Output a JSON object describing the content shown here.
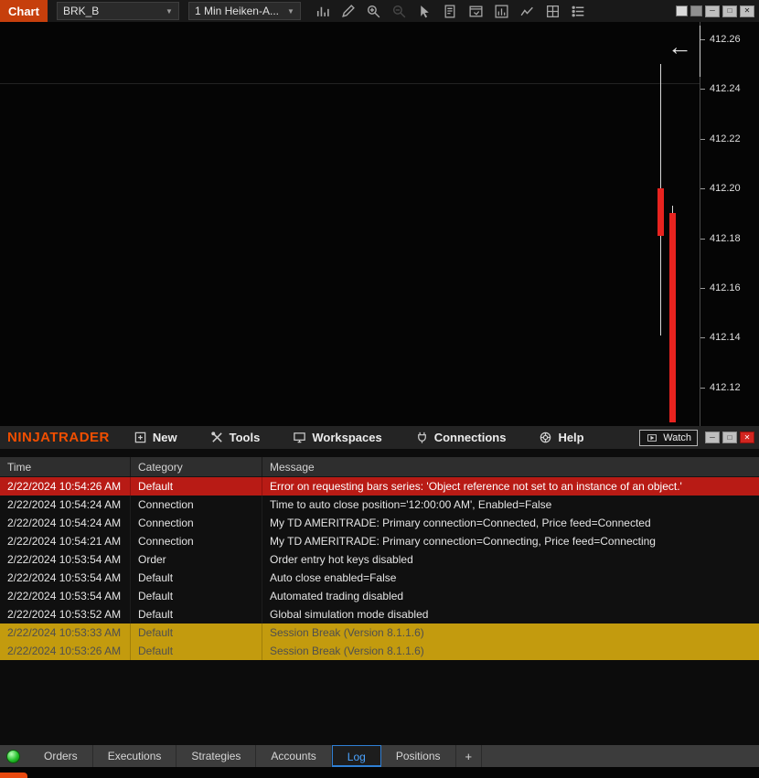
{
  "chart_window": {
    "title": "Chart",
    "instrument": "BRK_B",
    "period": "1 Min Heiken-A...",
    "back_arrow": "←",
    "toolbar_icons": [
      {
        "name": "chart-style-icon"
      },
      {
        "name": "drawing-tools-icon"
      },
      {
        "name": "zoom-in-icon"
      },
      {
        "name": "zoom-out-icon",
        "disabled": true
      },
      {
        "name": "cursor-icon"
      },
      {
        "name": "report-icon"
      },
      {
        "name": "window-link-icon"
      },
      {
        "name": "chart-trader-icon"
      },
      {
        "name": "indicators-icon"
      },
      {
        "name": "data-grid-icon"
      },
      {
        "name": "properties-icon"
      }
    ],
    "window_controls": [
      {
        "name": "layout-square-light-icon",
        "glyph": "",
        "fill": "#d9d9d9"
      },
      {
        "name": "layout-square-gray-icon",
        "glyph": "",
        "fill": "#8f8f8f"
      },
      {
        "name": "minimize-button",
        "glyph": "─"
      },
      {
        "name": "maximize-button",
        "glyph": "□"
      },
      {
        "name": "close-button",
        "glyph": "✕"
      }
    ]
  },
  "chart_data": {
    "type": "candlestick",
    "title": "BRK_B 1 Min Heiken-Ashi",
    "ylim": [
      412.1045,
      412.267
    ],
    "y_ticks": [
      "412.26",
      "412.24",
      "412.22",
      "412.20",
      "412.18",
      "412.16",
      "412.14",
      "412.12"
    ],
    "gridlines": [
      412.2425
    ],
    "candles": [
      {
        "x": 719,
        "open": 412.2,
        "high": 412.25,
        "low": 412.141,
        "close": 412.181,
        "direction": "down"
      },
      {
        "x": 732,
        "open": 412.19,
        "high": 412.193,
        "low": 412.106,
        "close": 412.106,
        "direction": "down"
      }
    ],
    "down_color": "#e8231f",
    "wick_color": "#d8d8d8"
  },
  "control_center": {
    "logo": "NINJATRADER",
    "menus": [
      {
        "name": "menu-new",
        "icon": "new-icon",
        "label": "New"
      },
      {
        "name": "menu-tools",
        "icon": "tools-icon",
        "label": "Tools"
      },
      {
        "name": "menu-workspaces",
        "icon": "workspaces-icon",
        "label": "Workspaces"
      },
      {
        "name": "menu-connections",
        "icon": "connections-icon",
        "label": "Connections"
      },
      {
        "name": "menu-help",
        "icon": "help-icon",
        "label": "Help"
      }
    ],
    "watch_button": {
      "label": "Watch"
    },
    "window_controls": [
      {
        "name": "minimize-button",
        "glyph": "─"
      },
      {
        "name": "maximize-button",
        "glyph": "□"
      },
      {
        "name": "close-button",
        "glyph": "✕",
        "bg": "#d22620",
        "fg": "#ffffff"
      }
    ],
    "log_table": {
      "columns": [
        "Time",
        "Category",
        "Message"
      ],
      "rows": [
        {
          "time": "2/22/2024 10:54:26 AM",
          "category": "Default",
          "message": "Error on requesting bars series: 'Object reference not set to an instance of an object.'",
          "type": "error"
        },
        {
          "time": "2/22/2024 10:54:24 AM",
          "category": "Connection",
          "message": "Time to auto close position='12:00:00 AM', Enabled=False",
          "type": "normal"
        },
        {
          "time": "2/22/2024 10:54:24 AM",
          "category": "Connection",
          "message": "My TD AMERITRADE: Primary connection=Connected, Price feed=Connected",
          "type": "normal"
        },
        {
          "time": "2/22/2024 10:54:21 AM",
          "category": "Connection",
          "message": "My TD AMERITRADE: Primary connection=Connecting, Price feed=Connecting",
          "type": "normal"
        },
        {
          "time": "2/22/2024 10:53:54 AM",
          "category": "Order",
          "message": "Order entry hot keys disabled",
          "type": "normal"
        },
        {
          "time": "2/22/2024 10:53:54 AM",
          "category": "Default",
          "message": "Auto close enabled=False",
          "type": "normal"
        },
        {
          "time": "2/22/2024 10:53:54 AM",
          "category": "Default",
          "message": "Automated trading disabled",
          "type": "normal"
        },
        {
          "time": "2/22/2024 10:53:52 AM",
          "category": "Default",
          "message": "Global simulation mode disabled",
          "type": "normal"
        },
        {
          "time": "2/22/2024 10:53:33 AM",
          "category": "Default",
          "message": "Session Break (Version 8.1.1.6)",
          "type": "session"
        },
        {
          "time": "2/22/2024 10:53:26 AM",
          "category": "Default",
          "message": "Session Break (Version 8.1.1.6)",
          "type": "session"
        }
      ]
    },
    "tabs": [
      {
        "label": "Orders"
      },
      {
        "label": "Executions"
      },
      {
        "label": "Strategies"
      },
      {
        "label": "Accounts"
      },
      {
        "label": "Log",
        "active": true
      },
      {
        "label": "Positions"
      },
      {
        "label": "+",
        "add": true
      }
    ],
    "status": {
      "connected_color": "#25c12b"
    }
  },
  "colors": {
    "brand_orange": "#f04e00",
    "chart_title_bg": "#c63f0c",
    "error_row": "#b81b15",
    "session_row": "#c39b0e",
    "active_tab_text": "#4aa3ff"
  }
}
